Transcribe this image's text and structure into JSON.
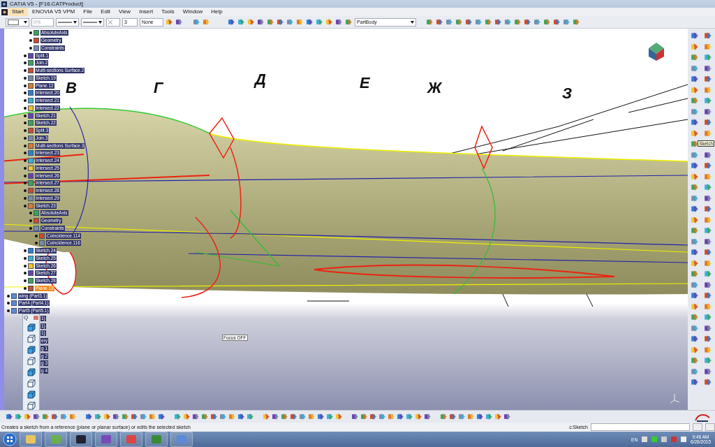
{
  "window": {
    "title": "CATIA V5 - [F16.CATProduct]"
  },
  "menu": [
    {
      "label": "Start",
      "selected": true
    },
    {
      "label": "ENOVIA V5 VPM",
      "selected": false
    },
    {
      "label": "File",
      "selected": false
    },
    {
      "label": "Edit",
      "selected": false
    },
    {
      "label": "View",
      "selected": false
    },
    {
      "label": "Insert",
      "selected": false
    },
    {
      "label": "Tools",
      "selected": false
    },
    {
      "label": "Window",
      "selected": false
    },
    {
      "label": "Help",
      "selected": false
    }
  ],
  "toolbar": {
    "fill_percent": "0%",
    "thickness": "3",
    "layer": "None",
    "body": "PartBody"
  },
  "tree": [
    {
      "label": "AbsoluteAxis",
      "selected": false
    },
    {
      "label": "Geometry",
      "selected": false
    },
    {
      "label": "Constraints",
      "selected": false
    }
  ],
  "tree_main": [
    {
      "label": "Split.1",
      "selected": false
    },
    {
      "label": "Join.2",
      "selected": false
    },
    {
      "label": "Multi-sections Surface.2",
      "selected": false
    },
    {
      "label": "Sketch.19",
      "selected": false
    },
    {
      "label": "Plane.12",
      "selected": false
    },
    {
      "label": "Intersect.20",
      "selected": false
    },
    {
      "label": "Intersect.21",
      "selected": false
    },
    {
      "label": "Intersect.22",
      "selected": false
    },
    {
      "label": "Sketch.21",
      "selected": false
    },
    {
      "label": "Sketch.22",
      "selected": false
    },
    {
      "label": "Split.3",
      "selected": false
    },
    {
      "label": "Join.3",
      "selected": false
    },
    {
      "label": "Multi-sections Surface.3",
      "selected": false
    },
    {
      "label": "Intersect.23",
      "selected": false
    },
    {
      "label": "Intersect.24",
      "selected": false
    },
    {
      "label": "Intersect.25",
      "selected": false
    },
    {
      "label": "Intersect.26",
      "selected": false
    },
    {
      "label": "Intersect.27",
      "selected": false
    },
    {
      "label": "Intersect.28",
      "selected": false
    },
    {
      "label": "Intersect.29",
      "selected": false
    },
    {
      "label": "Sketch.23",
      "selected": false,
      "children": [
        {
          "label": "AbsoluteAxis",
          "selected": false
        },
        {
          "label": "Geometry",
          "selected": false
        },
        {
          "label": "Constraints",
          "selected": false,
          "children": [
            {
              "label": "Coincidence.114",
              "selected": false
            },
            {
              "label": "Coincidence.116",
              "selected": false
            }
          ]
        }
      ]
    },
    {
      "label": "Sketch.24",
      "selected": false
    },
    {
      "label": "Sketch.25",
      "selected": false
    },
    {
      "label": "Sketch.26",
      "selected": false
    },
    {
      "label": "Sketch.27",
      "selected": false
    },
    {
      "label": "Sketch.28",
      "selected": false
    },
    {
      "label": "Plane.13",
      "selected": true
    }
  ],
  "tree_parts": [
    {
      "label": "wing (Part3.1)"
    },
    {
      "label": "Part4 (Part4.1)"
    },
    {
      "label": "Part5 (Part5.1)"
    }
  ],
  "tree_hidden_fragments": [
    "1)",
    "1)",
    "1)",
    "ery",
    "g 1",
    "g 2",
    "g 3",
    "g 4"
  ],
  "palette": {
    "title": "Q"
  },
  "canvas_letters": [
    "В",
    "Г",
    "Д",
    "Е",
    "Ж",
    "З"
  ],
  "focus_label": "Focus OFF",
  "tooltip": "Sketch",
  "status": {
    "message": "Creates a sketch from a reference (plane or planar surface) or edits the selected sketch",
    "command_label": "c:Sketch"
  },
  "taskbar": {
    "language": "EN",
    "time": "9:46 AM",
    "date": "6/26/2015"
  }
}
